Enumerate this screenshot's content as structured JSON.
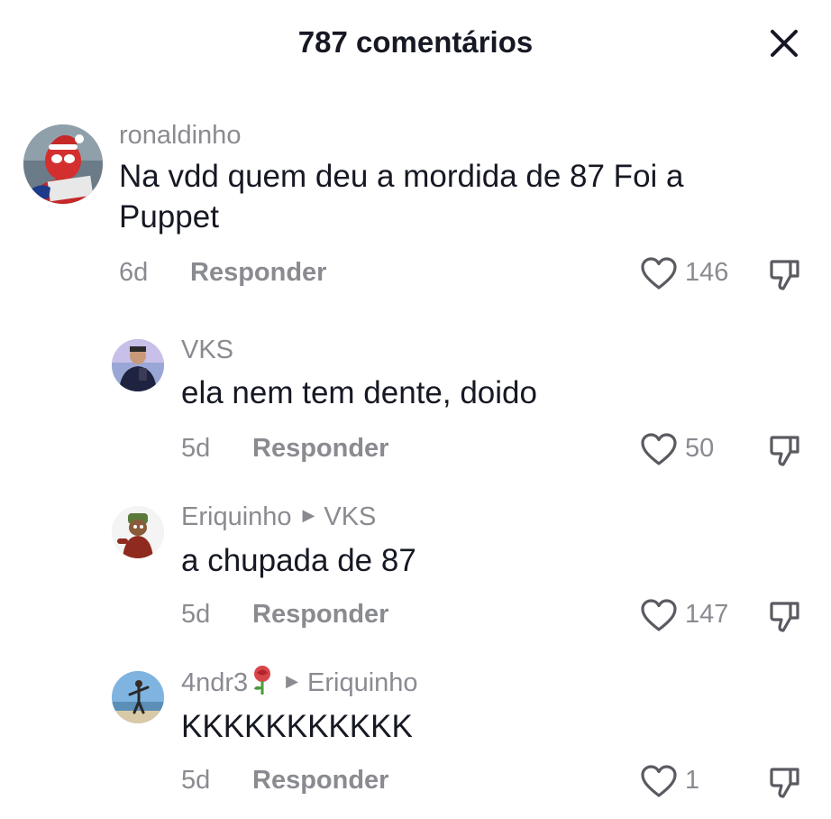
{
  "header": {
    "title": "787 comentários",
    "close_icon": "close-icon"
  },
  "comments": [
    {
      "username": "ronaldinho",
      "text": "Na vdd quem deu a mordida de 87 Foi a\nPuppet",
      "age": "6d",
      "reply_label": "Responder",
      "likes": "146",
      "avatar": "spiderman-avatar"
    },
    {
      "username": "VKS",
      "text": "ela nem tem dente, doido",
      "age": "5d",
      "reply_label": "Responder",
      "likes": "50",
      "avatar": "person-selfie-avatar"
    },
    {
      "username": "Eriquinho",
      "reply_to": "VKS",
      "text": "a chupada de 87",
      "age": "5d",
      "reply_label": "Responder",
      "likes": "147",
      "avatar": "cartoon-avatar"
    },
    {
      "username": "4ndr3",
      "username_emoji": "rose-emoji",
      "reply_to": "Eriquinho",
      "text": "KKKKKKKKKKK",
      "age": "5d",
      "reply_label": "Responder",
      "likes": "1",
      "avatar": "beach-avatar"
    }
  ],
  "colors": {
    "text": "#161823",
    "secondary": "#8a8b91",
    "background": "#ffffff"
  }
}
